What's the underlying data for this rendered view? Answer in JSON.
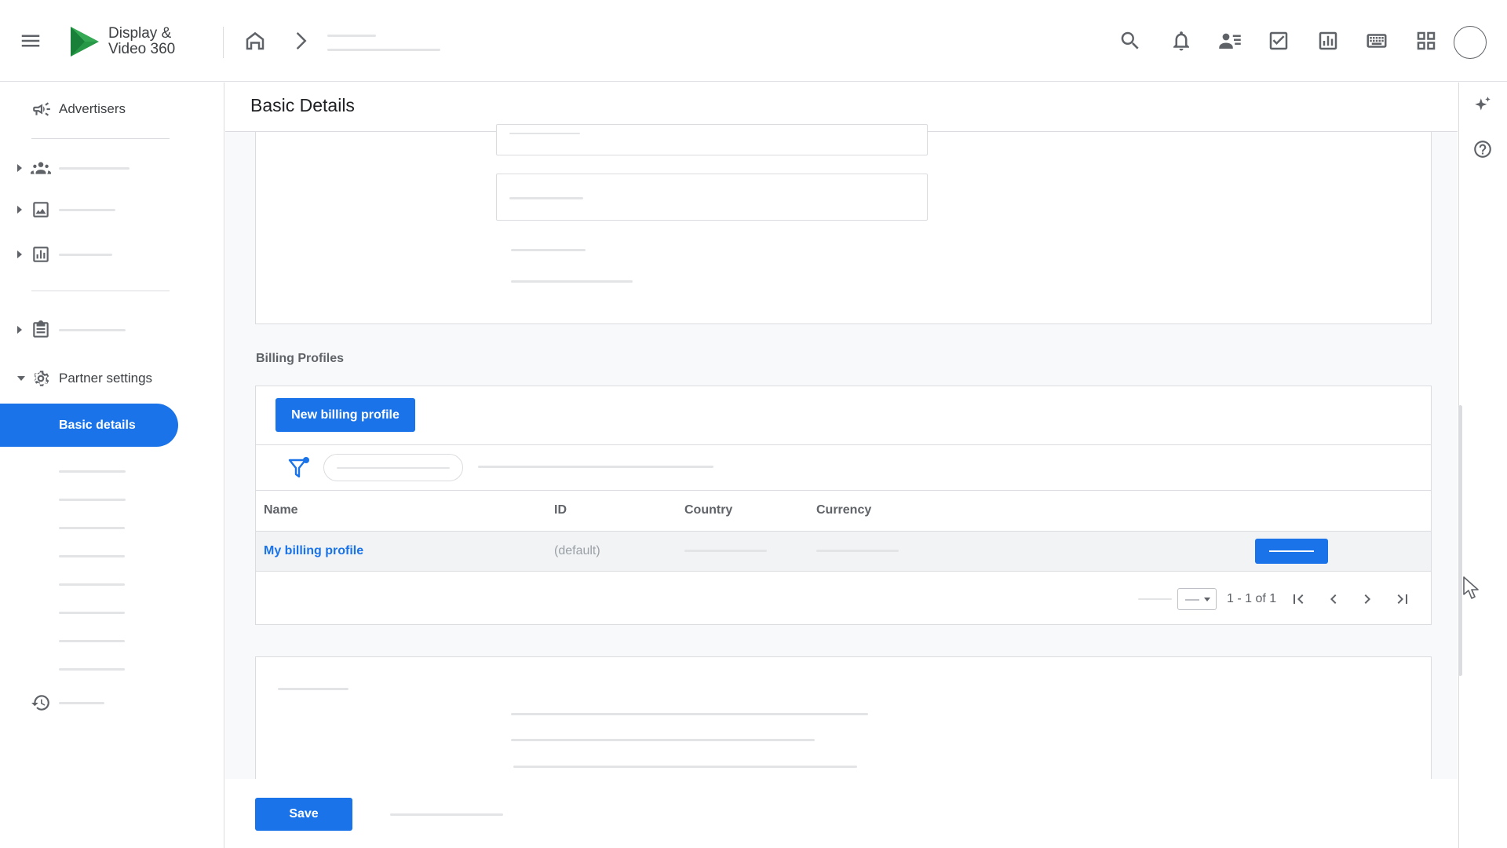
{
  "app": {
    "brand_line1": "Display &",
    "brand_line2": "Video 360"
  },
  "sidebar": {
    "advertisers_label": "Advertisers",
    "partner_settings_label": "Partner settings",
    "active_item_label": "Basic details"
  },
  "main": {
    "page_title": "Basic Details",
    "billing_section_title": "Billing Profiles",
    "new_billing_button": "New billing profile",
    "table": {
      "columns": [
        "Name",
        "ID",
        "Country",
        "Currency"
      ],
      "rows": [
        {
          "name": "My billing profile",
          "id": "(default)"
        }
      ]
    },
    "pagination_text": "1 - 1 of 1"
  },
  "footer": {
    "save_label": "Save"
  },
  "colors": {
    "accent": "#1a73e8",
    "icon": "#5f6368",
    "border": "#dadce0",
    "background": "#f8f9fa"
  },
  "icons": [
    "menu-icon",
    "dv360-logo-icon",
    "home-icon",
    "chevron-right-icon",
    "search-icon",
    "bell-icon",
    "account-list-icon",
    "checklist-icon",
    "report-icon",
    "keyboard-icon",
    "apps-grid-icon",
    "megaphone-icon",
    "groups-icon",
    "image-icon",
    "bar-chart-icon",
    "clipboard-icon",
    "gear-icon",
    "history-icon",
    "sparkle-icon",
    "help-icon",
    "filter-icon"
  ]
}
